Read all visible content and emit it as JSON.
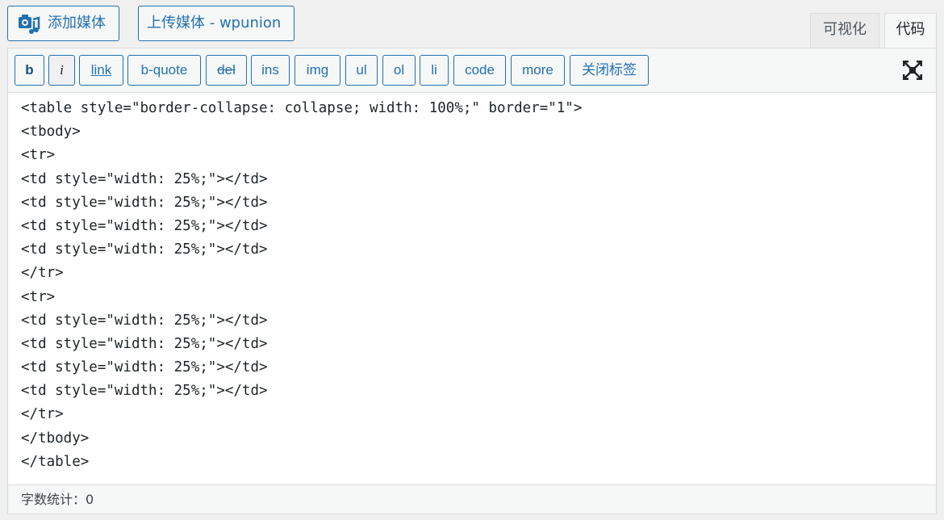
{
  "media_buttons": {
    "add_media_label": "添加媒体",
    "upload_media_label": "上传媒体 - wpunion"
  },
  "tabs": {
    "visual_label": "可视化",
    "code_label": "代码",
    "active": "code"
  },
  "toolbar": {
    "buttons": [
      {
        "label": "b"
      },
      {
        "label": "i"
      },
      {
        "label": "link"
      },
      {
        "label": "b-quote"
      },
      {
        "label": "del"
      },
      {
        "label": "ins"
      },
      {
        "label": "img"
      },
      {
        "label": "ul"
      },
      {
        "label": "ol"
      },
      {
        "label": "li"
      },
      {
        "label": "code"
      },
      {
        "label": "more"
      },
      {
        "label": "关闭标签"
      }
    ],
    "fullscreen_icon": "fullscreen-icon"
  },
  "editor": {
    "lines": [
      "<table style=\"border-collapse: collapse; width: 100%;\" border=\"1\">",
      "<tbody>",
      "<tr>",
      "<td style=\"width: 25%;\"></td>",
      "<td style=\"width: 25%;\"></td>",
      "<td style=\"width: 25%;\"></td>",
      "<td style=\"width: 25%;\"></td>",
      "</tr>",
      "<tr>",
      "<td style=\"width: 25%;\"></td>",
      "<td style=\"width: 25%;\"></td>",
      "<td style=\"width: 25%;\"></td>",
      "<td style=\"width: 25%;\"></td>",
      "</tr>",
      "</tbody>",
      "</table>"
    ]
  },
  "status": {
    "word_count_label": "字数统计：0"
  },
  "colors": {
    "accent": "#2271b1",
    "text": "#1d2327"
  }
}
